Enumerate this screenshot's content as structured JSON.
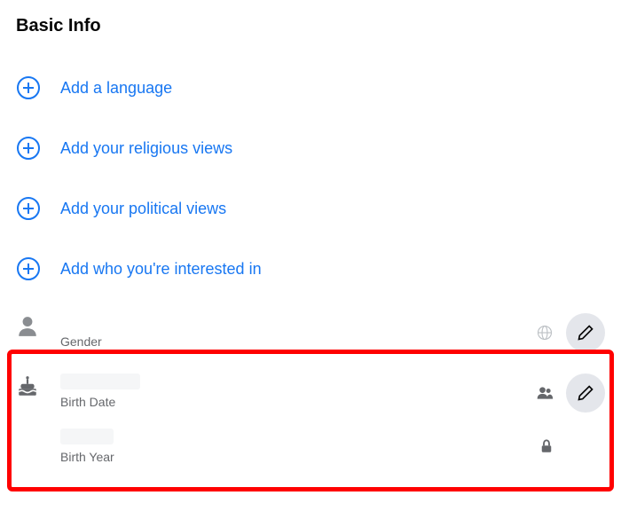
{
  "section": {
    "title": "Basic Info"
  },
  "add_items": [
    {
      "label": "Add a language"
    },
    {
      "label": "Add your religious views"
    },
    {
      "label": "Add your political views"
    },
    {
      "label": "Add who you're interested in"
    }
  ],
  "gender": {
    "label": "Gender"
  },
  "birth_date": {
    "label": "Birth Date"
  },
  "birth_year": {
    "label": "Birth Year"
  }
}
